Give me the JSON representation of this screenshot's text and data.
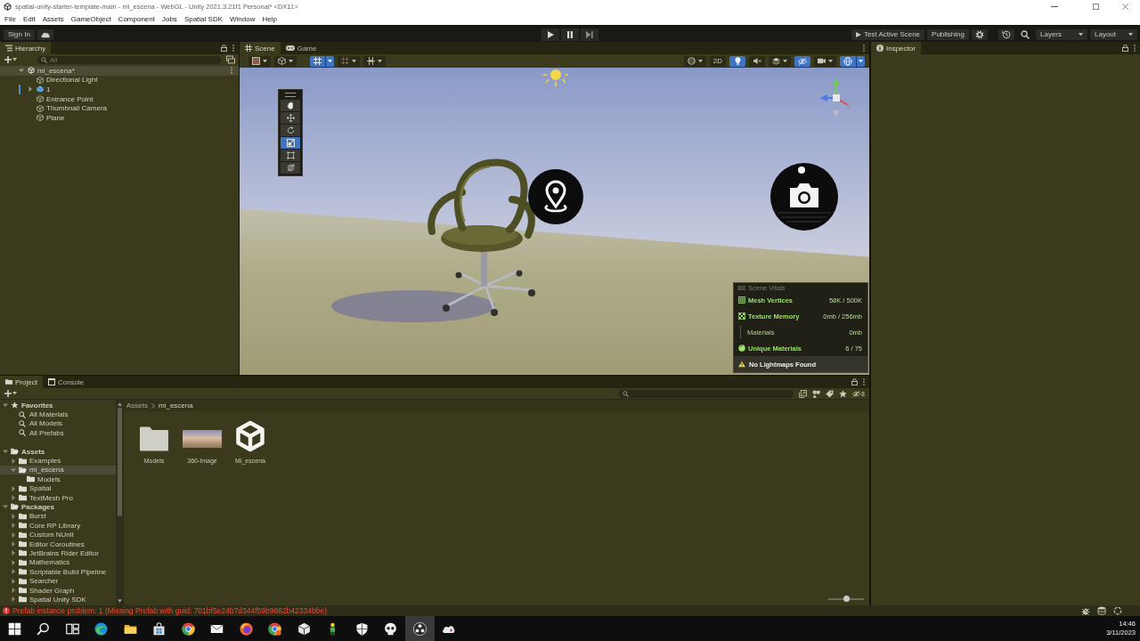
{
  "window": {
    "title": "spatial-unity-starter-template-main - mi_escena - WebGL - Unity 2021.3.21f1 Personal* <DX11>"
  },
  "menu_bar": [
    "File",
    "Edit",
    "Assets",
    "GameObject",
    "Component",
    "Jobs",
    "Spatial SDK",
    "Window",
    "Help"
  ],
  "toolbar": {
    "sign_in": "Sign In",
    "test_scene": "Test Active Scene",
    "publishing": "Publishing",
    "layers": "Layers",
    "layout": "Layout"
  },
  "hierarchy": {
    "tab": "Hierarchy",
    "search": {
      "placeholder": "All"
    },
    "tree": [
      {
        "label": "mi_escena*",
        "kind": "scene",
        "expanded": true,
        "selected": false,
        "children": [
          {
            "label": "Directional Light",
            "kind": "object",
            "selected": false,
            "modified": false
          },
          {
            "label": "1",
            "kind": "prefab",
            "expanded": false,
            "selected": false,
            "modified": true
          },
          {
            "label": "Entrance Point",
            "kind": "object",
            "selected": false,
            "modified": false
          },
          {
            "label": "Thumbnail Camera",
            "kind": "object",
            "selected": false,
            "modified": false
          },
          {
            "label": "Plane",
            "kind": "object",
            "selected": false,
            "modified": false
          }
        ]
      }
    ]
  },
  "scene_view": {
    "tabs": [
      {
        "label": "Scene",
        "kind": "scene",
        "selected": true
      },
      {
        "label": "Game",
        "kind": "game",
        "selected": false
      }
    ],
    "toolbar": {
      "grid_snap": true,
      "mode_2d": {
        "label": "2D",
        "on": false
      },
      "lighting": true,
      "audio": false,
      "visibility": true,
      "gizmos": true
    },
    "tools": [
      {
        "kind": "hand",
        "selected": false
      },
      {
        "kind": "move",
        "selected": false
      },
      {
        "kind": "rotate",
        "selected": false
      },
      {
        "kind": "scale",
        "selected": true
      },
      {
        "kind": "rect",
        "selected": false
      },
      {
        "kind": "transform",
        "selected": false
      }
    ],
    "vitals": {
      "title": "Scene Vitals",
      "rows": [
        {
          "kind": "mesh",
          "label": "Mesh Vertices",
          "value": "58K / 500K"
        },
        {
          "kind": "texture",
          "label": "Texture Memory",
          "value": "0mb / 256mb"
        },
        {
          "kind": "detail",
          "label": "Materials",
          "value": "0mb"
        },
        {
          "kind": "material",
          "label": "Unique Materials",
          "value": "6 / 75"
        },
        {
          "kind": "warning",
          "label": "No Lightmaps Found"
        }
      ]
    }
  },
  "inspector": {
    "tab": "Inspector"
  },
  "project": {
    "tabs": [
      {
        "label": "Project",
        "kind": "project",
        "selected": true
      },
      {
        "label": "Console",
        "kind": "console",
        "selected": false
      }
    ],
    "hidden_packages": "8",
    "tree": [
      {
        "label": "Favorites",
        "kind": "favorites",
        "expanded": true,
        "selected": false,
        "children": [
          {
            "label": "All Materials",
            "kind": "search",
            "selected": false
          },
          {
            "label": "All Models",
            "kind": "search",
            "selected": false
          },
          {
            "label": "All Prefabs",
            "kind": "search",
            "selected": false
          }
        ]
      },
      {
        "label": "Assets",
        "kind": "root",
        "expanded": true,
        "selected": false,
        "children": [
          {
            "label": "Examples",
            "kind": "folder",
            "expanded": false,
            "selected": false
          },
          {
            "label": "mi_escena",
            "kind": "folder",
            "expanded": true,
            "selected": true,
            "children": [
              {
                "label": "Models",
                "kind": "folder",
                "selected": false
              }
            ]
          },
          {
            "label": "Spatial",
            "kind": "folder",
            "expanded": false,
            "selected": false
          },
          {
            "label": "TextMesh Pro",
            "kind": "folder",
            "expanded": false,
            "selected": false
          }
        ]
      },
      {
        "label": "Packages",
        "kind": "root",
        "expanded": true,
        "selected": false,
        "children": [
          {
            "label": "Burst",
            "kind": "folder",
            "expanded": false,
            "selected": false
          },
          {
            "label": "Core RP Library",
            "kind": "folder",
            "expanded": false,
            "selected": false
          },
          {
            "label": "Custom NUnit",
            "kind": "folder",
            "expanded": false,
            "selected": false
          },
          {
            "label": "Editor Coroutines",
            "kind": "folder",
            "expanded": false,
            "selected": false
          },
          {
            "label": "JetBrains Rider Editor",
            "kind": "folder",
            "expanded": false,
            "selected": false
          },
          {
            "label": "Mathematics",
            "kind": "folder",
            "expanded": false,
            "selected": false
          },
          {
            "label": "Scriptable Build Pipeline",
            "kind": "folder",
            "expanded": false,
            "selected": false
          },
          {
            "label": "Searcher",
            "kind": "folder",
            "expanded": false,
            "selected": false
          },
          {
            "label": "Shader Graph",
            "kind": "folder",
            "expanded": false,
            "selected": false
          },
          {
            "label": "Spatial Unity SDK",
            "kind": "folder",
            "expanded": false,
            "selected": false
          }
        ]
      }
    ],
    "breadcrumb": [
      "Assets",
      "mi_escena"
    ],
    "items": [
      {
        "label": "Models",
        "kind": "folder",
        "selected": false
      },
      {
        "label": "360-Image",
        "kind": "image",
        "selected": false
      },
      {
        "label": "Mi_escena",
        "kind": "scene",
        "selected": false
      }
    ],
    "zoom_slider": {
      "level": 0.5
    }
  },
  "status_bar": {
    "kind": "error",
    "message": "Prefab instance problem: 1 (Missing Prefab with guid: 701bf5e24b7d344f59b9862b42334bbe)"
  },
  "taskbar": {
    "items": [
      {
        "kind": "start",
        "active": false
      },
      {
        "kind": "search",
        "active": false
      },
      {
        "kind": "taskview",
        "active": false
      },
      {
        "kind": "swirl",
        "active": false
      },
      {
        "kind": "files",
        "active": false
      },
      {
        "kind": "store",
        "active": false
      },
      {
        "kind": "orb",
        "active": false
      },
      {
        "kind": "mail",
        "active": false
      },
      {
        "kind": "fox",
        "active": false
      },
      {
        "kind": "orbbadge",
        "active": false
      },
      {
        "kind": "cube",
        "active": false
      },
      {
        "kind": "figure",
        "active": false
      },
      {
        "kind": "shield",
        "active": false
      },
      {
        "kind": "mask",
        "active": false
      },
      {
        "kind": "recorder",
        "active": true
      },
      {
        "kind": "cloud",
        "active": false
      }
    ],
    "time": "14:46",
    "date": "3/11/2023"
  }
}
